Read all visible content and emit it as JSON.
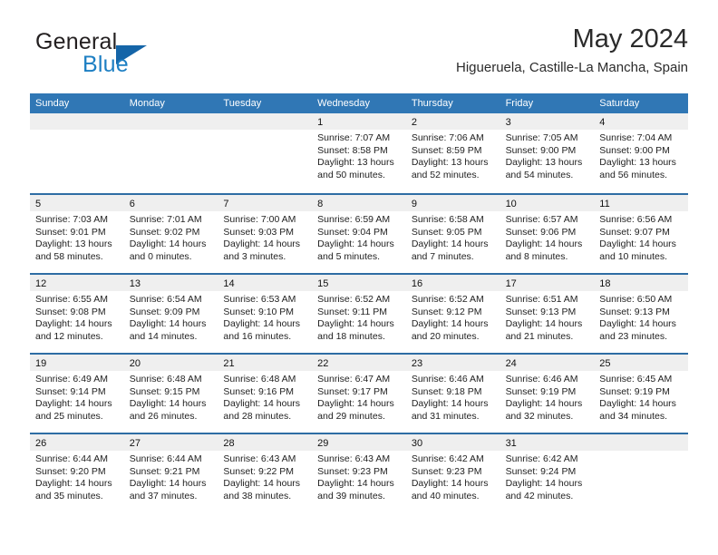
{
  "brand": {
    "name_part1": "General",
    "name_part2": "Blue",
    "triangle_color": "#1565a8",
    "blue_color": "#1d7fc3"
  },
  "header": {
    "month_title": "May 2024",
    "location": "Higueruela, Castille-La Mancha, Spain"
  },
  "theme": {
    "header_blue": "#3077b5",
    "row_divider_blue": "#2e6da4",
    "daynum_band": "#efefef"
  },
  "weekdays": [
    "Sunday",
    "Monday",
    "Tuesday",
    "Wednesday",
    "Thursday",
    "Friday",
    "Saturday"
  ],
  "weeks": [
    [
      {
        "day": "",
        "empty": true
      },
      {
        "day": "",
        "empty": true
      },
      {
        "day": "",
        "empty": true
      },
      {
        "day": "1",
        "sunrise": "Sunrise: 7:07 AM",
        "sunset": "Sunset: 8:58 PM",
        "daylight": "Daylight: 13 hours and 50 minutes."
      },
      {
        "day": "2",
        "sunrise": "Sunrise: 7:06 AM",
        "sunset": "Sunset: 8:59 PM",
        "daylight": "Daylight: 13 hours and 52 minutes."
      },
      {
        "day": "3",
        "sunrise": "Sunrise: 7:05 AM",
        "sunset": "Sunset: 9:00 PM",
        "daylight": "Daylight: 13 hours and 54 minutes."
      },
      {
        "day": "4",
        "sunrise": "Sunrise: 7:04 AM",
        "sunset": "Sunset: 9:00 PM",
        "daylight": "Daylight: 13 hours and 56 minutes."
      }
    ],
    [
      {
        "day": "5",
        "sunrise": "Sunrise: 7:03 AM",
        "sunset": "Sunset: 9:01 PM",
        "daylight": "Daylight: 13 hours and 58 minutes."
      },
      {
        "day": "6",
        "sunrise": "Sunrise: 7:01 AM",
        "sunset": "Sunset: 9:02 PM",
        "daylight": "Daylight: 14 hours and 0 minutes."
      },
      {
        "day": "7",
        "sunrise": "Sunrise: 7:00 AM",
        "sunset": "Sunset: 9:03 PM",
        "daylight": "Daylight: 14 hours and 3 minutes."
      },
      {
        "day": "8",
        "sunrise": "Sunrise: 6:59 AM",
        "sunset": "Sunset: 9:04 PM",
        "daylight": "Daylight: 14 hours and 5 minutes."
      },
      {
        "day": "9",
        "sunrise": "Sunrise: 6:58 AM",
        "sunset": "Sunset: 9:05 PM",
        "daylight": "Daylight: 14 hours and 7 minutes."
      },
      {
        "day": "10",
        "sunrise": "Sunrise: 6:57 AM",
        "sunset": "Sunset: 9:06 PM",
        "daylight": "Daylight: 14 hours and 8 minutes."
      },
      {
        "day": "11",
        "sunrise": "Sunrise: 6:56 AM",
        "sunset": "Sunset: 9:07 PM",
        "daylight": "Daylight: 14 hours and 10 minutes."
      }
    ],
    [
      {
        "day": "12",
        "sunrise": "Sunrise: 6:55 AM",
        "sunset": "Sunset: 9:08 PM",
        "daylight": "Daylight: 14 hours and 12 minutes."
      },
      {
        "day": "13",
        "sunrise": "Sunrise: 6:54 AM",
        "sunset": "Sunset: 9:09 PM",
        "daylight": "Daylight: 14 hours and 14 minutes."
      },
      {
        "day": "14",
        "sunrise": "Sunrise: 6:53 AM",
        "sunset": "Sunset: 9:10 PM",
        "daylight": "Daylight: 14 hours and 16 minutes."
      },
      {
        "day": "15",
        "sunrise": "Sunrise: 6:52 AM",
        "sunset": "Sunset: 9:11 PM",
        "daylight": "Daylight: 14 hours and 18 minutes."
      },
      {
        "day": "16",
        "sunrise": "Sunrise: 6:52 AM",
        "sunset": "Sunset: 9:12 PM",
        "daylight": "Daylight: 14 hours and 20 minutes."
      },
      {
        "day": "17",
        "sunrise": "Sunrise: 6:51 AM",
        "sunset": "Sunset: 9:13 PM",
        "daylight": "Daylight: 14 hours and 21 minutes."
      },
      {
        "day": "18",
        "sunrise": "Sunrise: 6:50 AM",
        "sunset": "Sunset: 9:13 PM",
        "daylight": "Daylight: 14 hours and 23 minutes."
      }
    ],
    [
      {
        "day": "19",
        "sunrise": "Sunrise: 6:49 AM",
        "sunset": "Sunset: 9:14 PM",
        "daylight": "Daylight: 14 hours and 25 minutes."
      },
      {
        "day": "20",
        "sunrise": "Sunrise: 6:48 AM",
        "sunset": "Sunset: 9:15 PM",
        "daylight": "Daylight: 14 hours and 26 minutes."
      },
      {
        "day": "21",
        "sunrise": "Sunrise: 6:48 AM",
        "sunset": "Sunset: 9:16 PM",
        "daylight": "Daylight: 14 hours and 28 minutes."
      },
      {
        "day": "22",
        "sunrise": "Sunrise: 6:47 AM",
        "sunset": "Sunset: 9:17 PM",
        "daylight": "Daylight: 14 hours and 29 minutes."
      },
      {
        "day": "23",
        "sunrise": "Sunrise: 6:46 AM",
        "sunset": "Sunset: 9:18 PM",
        "daylight": "Daylight: 14 hours and 31 minutes."
      },
      {
        "day": "24",
        "sunrise": "Sunrise: 6:46 AM",
        "sunset": "Sunset: 9:19 PM",
        "daylight": "Daylight: 14 hours and 32 minutes."
      },
      {
        "day": "25",
        "sunrise": "Sunrise: 6:45 AM",
        "sunset": "Sunset: 9:19 PM",
        "daylight": "Daylight: 14 hours and 34 minutes."
      }
    ],
    [
      {
        "day": "26",
        "sunrise": "Sunrise: 6:44 AM",
        "sunset": "Sunset: 9:20 PM",
        "daylight": "Daylight: 14 hours and 35 minutes."
      },
      {
        "day": "27",
        "sunrise": "Sunrise: 6:44 AM",
        "sunset": "Sunset: 9:21 PM",
        "daylight": "Daylight: 14 hours and 37 minutes."
      },
      {
        "day": "28",
        "sunrise": "Sunrise: 6:43 AM",
        "sunset": "Sunset: 9:22 PM",
        "daylight": "Daylight: 14 hours and 38 minutes."
      },
      {
        "day": "29",
        "sunrise": "Sunrise: 6:43 AM",
        "sunset": "Sunset: 9:23 PM",
        "daylight": "Daylight: 14 hours and 39 minutes."
      },
      {
        "day": "30",
        "sunrise": "Sunrise: 6:42 AM",
        "sunset": "Sunset: 9:23 PM",
        "daylight": "Daylight: 14 hours and 40 minutes."
      },
      {
        "day": "31",
        "sunrise": "Sunrise: 6:42 AM",
        "sunset": "Sunset: 9:24 PM",
        "daylight": "Daylight: 14 hours and 42 minutes."
      },
      {
        "day": "",
        "empty": true
      }
    ]
  ]
}
